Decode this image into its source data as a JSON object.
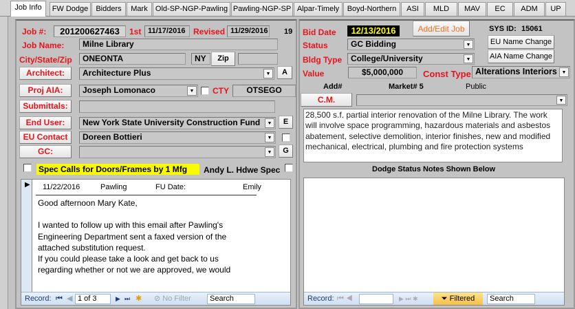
{
  "tabs": [
    "Job Info",
    "FW Dodge",
    "Bidders",
    "Mark",
    "Old-SP-NGP-Pawling",
    "Pawling-NGP-SP",
    "Alpar-Timely",
    "Boyd-Northern",
    "ASI",
    "MLD",
    "MAV",
    "EC",
    "ADM",
    "UP"
  ],
  "job": {
    "job_label": "Job #:",
    "job_number": "201200627463",
    "first_label": "1st",
    "first_date": "11/17/2016",
    "revised_label": "Revised",
    "revised_date": "11/29/2016",
    "count": "19",
    "name_label": "Job Name:",
    "name": "Milne Library",
    "csz_label": "City/State/Zip",
    "city": "ONEONTA",
    "state": "NY",
    "zip_button": "Zip",
    "zip": "",
    "architect_button": "Architect:",
    "architect": "Architecture Plus",
    "a_button": "A",
    "proj_aia_button": "Proj AIA:",
    "proj_aia": "Joseph Lomonaco",
    "cty_label": "CTY",
    "county": "OTSEGO",
    "submittals_button": "Submittals:",
    "submittals": "",
    "end_user_button": "End User:",
    "end_user": "New York State University Construction Fund",
    "e_button": "E",
    "eu_contact_button": "EU Contact",
    "eu_contact": "Doreen Bottieri",
    "gc_button": "GC:",
    "gc": "",
    "g_button": "G",
    "spec_label": "Spec Calls for Doors/Frames by 1 Mfg",
    "hdwe_label": "Andy L. Hdwe Spec"
  },
  "notes": {
    "date": "11/22/2016",
    "company": "Pawling",
    "fu_label": "FU Date:",
    "user": "Emily",
    "lines": [
      "Good afternoon Mary Kate,",
      "",
      "I wanted to follow up with this email after Pawling's",
      "Engineering Department sent a faxed version of the",
      "attached substitution request.",
      "If you could please take a look and get back to us",
      "regarding whether or not we are approved, we would"
    ],
    "nav": {
      "record_label": "Record:",
      "position": "1 of 3",
      "filter": "No Filter",
      "search": "Search"
    }
  },
  "right": {
    "bid_label": "Bid Date",
    "bid_date": "12/13/2016",
    "add_edit_button": "Add/Edit Job",
    "sys_label": "SYS ID:",
    "sys_id": "15061",
    "eu_change_button": "EU Name Change",
    "aia_change_button": "AIA Name Change",
    "status_label": "Status",
    "status": "GC Bidding",
    "bldg_label": "Bldg Type",
    "bldg": "College/University",
    "value_label": "Value",
    "value": "$5,000,000",
    "const_label": "Const Type",
    "const": "Alterations Interiors",
    "add_label": "Add#",
    "market": "Market# 5",
    "public": "Public",
    "cm_button": "C.M.",
    "cm": "",
    "description": "28,500 s.f. partial interior renovation of the Milne Library. The work will involve space programming, hazardous materials and asbestos abatement, selective demolition, interior finishes, new and modified mechanical, electrical, plumbing and fire protection systems",
    "dodge_heading": "Dodge Status Notes Shown Below",
    "nav": {
      "record_label": "Record:",
      "filter": "Filtered",
      "search": "Search"
    }
  }
}
